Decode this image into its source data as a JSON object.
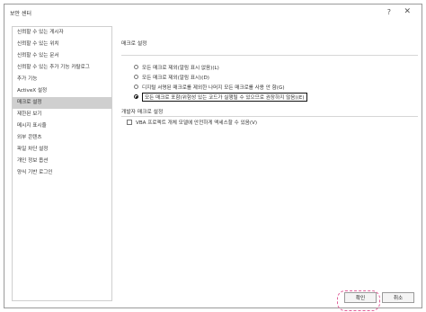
{
  "window": {
    "title": "보안 센터"
  },
  "titlebar": {
    "help_glyph": "?",
    "close_glyph": "✕"
  },
  "sidebar": {
    "items": [
      {
        "label": "신뢰할 수 있는 게시자"
      },
      {
        "label": "신뢰할 수 있는 위치"
      },
      {
        "label": "신뢰할 수 있는 문서"
      },
      {
        "label": "신뢰할 수 있는 추가 기능 카탈로그"
      },
      {
        "label": "추가 기능"
      },
      {
        "label": "ActiveX 설정"
      },
      {
        "label": "매크로 설정"
      },
      {
        "label": "제한된 보기"
      },
      {
        "label": "메시지 표시줄"
      },
      {
        "label": "외부 콘텐츠"
      },
      {
        "label": "파일 차단 설정"
      },
      {
        "label": "개인 정보 옵션"
      },
      {
        "label": "양식 기반 로그인"
      }
    ],
    "selected_index": 6
  },
  "macro_settings": {
    "title": "매크로 설정",
    "options": [
      {
        "label": "모든 매크로 제외(알림 표시 없음)(L)",
        "selected": false
      },
      {
        "label": "모든 매크로 제외(알림 표시)(D)",
        "selected": false
      },
      {
        "label": "디지털 서명된 매크로를 제외한 나머지 모든 매크로를 사용 안 함(G)",
        "selected": false
      },
      {
        "label": "모든 매크로 포함(위험성 있는 코드가 실행될 수 있으므로 권장하지 않음)(E)",
        "selected": true
      }
    ]
  },
  "developer_settings": {
    "title": "개발자 매크로 설정",
    "vba_checkbox_label": "VBA 프로젝트 개체 모델에 안전하게 액세스할 수 있음(V)",
    "vba_checked": false
  },
  "buttons": {
    "ok_label": "확인",
    "cancel_label": "취소"
  },
  "colors": {
    "highlight": "#e0609a",
    "selected_bg": "#cfcfcf"
  }
}
